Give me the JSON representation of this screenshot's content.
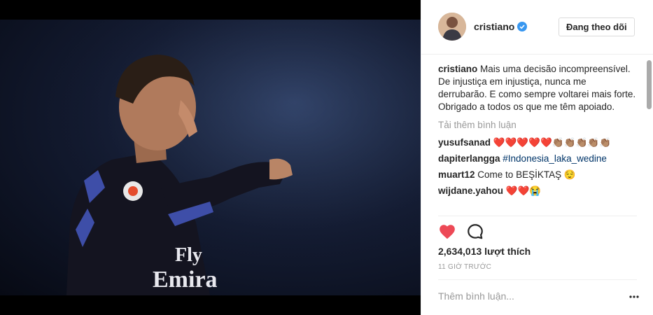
{
  "post": {
    "username": "cristiano",
    "follow_label": "Đang theo dõi",
    "caption_user": "cristiano",
    "caption_text": " Mais uma decisão incompreensível. De injustiça em injustiça, nunca me derrubarão. E como sempre voltarei mais forte. Obrigado a todos os que me têm apoiado.",
    "load_more": "Tải thêm bình luận",
    "comments": [
      {
        "user": "yusufsanad",
        "text": "❤️❤️❤️❤️❤️👏🏽👏🏽👏🏽👏🏽👏🏽"
      },
      {
        "user": "dapiterlangga",
        "hashtag": "#Indonesia_laka_wedine"
      },
      {
        "user": "muart12",
        "text": "Come to BEŞİKTAŞ 😌"
      },
      {
        "user": "wijdane.yahou",
        "text": "❤️❤️😭"
      }
    ],
    "likes": "2,634,013 lượt thích",
    "time": "11 GIỜ TRƯỚC",
    "add_comment_placeholder": "Thêm bình luận...",
    "jersey_text": "Fly Emirates",
    "icons": {
      "verified": "verified-badge-icon",
      "like": "heart-icon",
      "comment": "comment-bubble-icon",
      "more": "more-options-icon"
    },
    "colors": {
      "like_red": "#ed4956",
      "verified_blue": "#3897f0",
      "hashtag": "#003569",
      "muted": "#999999"
    }
  }
}
